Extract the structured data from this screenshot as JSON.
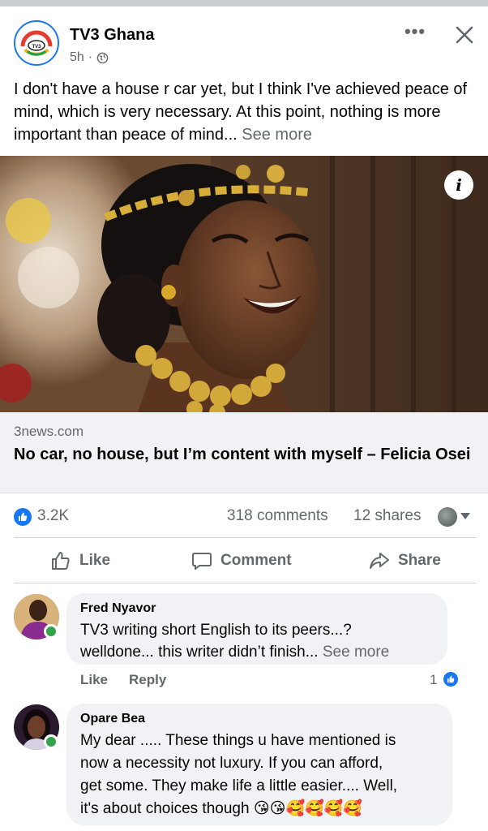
{
  "post": {
    "page_name": "TV3 Ghana",
    "time": "5h",
    "audience_icon": "globe-icon",
    "logo_text": "TV3",
    "text": "I don't have a house r car yet, but I think I've achieved peace of mind, which is very necessary. At this point, nothing is more important than peace of mind...",
    "see_more": "See more"
  },
  "link": {
    "domain": "3news.com",
    "title": "No car, no house, but I’m content with myself – Felicia Osei"
  },
  "stats": {
    "reactions": "3.2K",
    "comments": "318 comments",
    "shares": "12 shares"
  },
  "actions": {
    "like": "Like",
    "comment": "Comment",
    "share": "Share"
  },
  "comments": [
    {
      "author": "Fred Nyavor",
      "line1": "TV3 writing short English to its peers...?",
      "line2": "welldone... this writer didn’t finish...",
      "see_more": "See more",
      "like": "Like",
      "reply": "Reply",
      "likes": "1"
    },
    {
      "author": "Opare Bea",
      "line1": "My dear ..... These things u have mentioned is",
      "line2": "now a necessity not luxury. If you can afford,",
      "line3": "get some. They make life a little easier.... Well,",
      "line4": "it's about choices though",
      "emojis": "😘😘🥰🥰🥰🥰"
    }
  ],
  "colors": {
    "accent": "#1877f2",
    "muted": "#65676b",
    "bubble": "#f0f2f5",
    "online": "#31a24c"
  }
}
